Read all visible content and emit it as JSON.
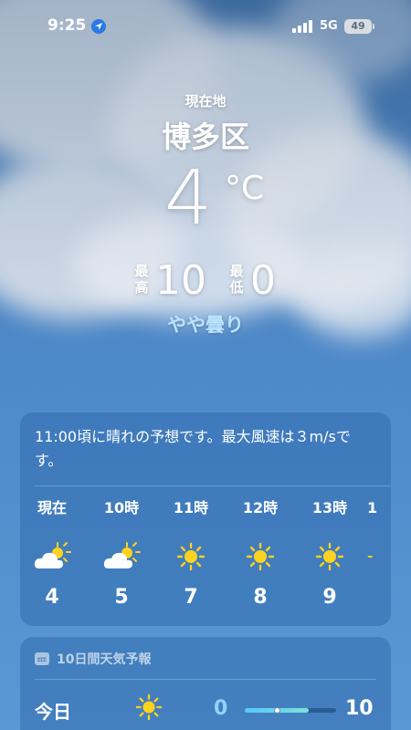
{
  "status_bar": {
    "time": "9:25",
    "network": "5G",
    "battery": "49"
  },
  "header": {
    "location_label": "現在地",
    "city": "博多区",
    "temperature": "4",
    "unit": "°C",
    "high_label": "最高",
    "high": "10",
    "low_label": "最低",
    "low": "0",
    "condition": "やや曇り"
  },
  "hourly": {
    "summary": "11:00頃に晴れの予想です。最大風速は３m/sです。",
    "hours": [
      {
        "label": "現在",
        "icon": "partly-cloudy-icon",
        "temp": "4"
      },
      {
        "label": "10時",
        "icon": "partly-cloudy-icon",
        "temp": "5"
      },
      {
        "label": "11時",
        "icon": "sun-icon",
        "temp": "7"
      },
      {
        "label": "12時",
        "icon": "sun-icon",
        "temp": "8"
      },
      {
        "label": "13時",
        "icon": "sun-icon",
        "temp": "9"
      },
      {
        "label": "1",
        "icon": "sun-icon",
        "temp": ""
      }
    ]
  },
  "daily": {
    "title": "10日間天気予報",
    "days": [
      {
        "name": "今日",
        "icon": "sun-icon",
        "low": "0",
        "high": "10",
        "range_start": 0.0,
        "range_end": 0.7,
        "current_position": 0.35
      }
    ]
  },
  "colors": {
    "accent_condition": "#b9e4ff",
    "low_temp": "#8fd3ff",
    "sun": "#ffd21f"
  }
}
